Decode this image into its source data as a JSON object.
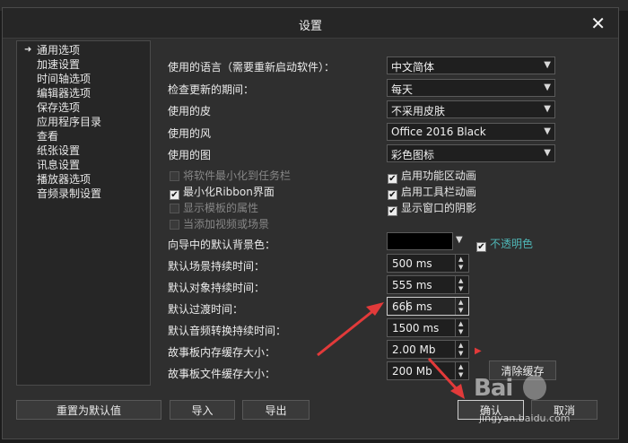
{
  "dialog": {
    "title": "设置",
    "close_label": "✕"
  },
  "nav": {
    "items": [
      {
        "label": "通用选项",
        "selected": true
      },
      {
        "label": "加速设置"
      },
      {
        "label": "时间轴选项"
      },
      {
        "label": "编辑器选项"
      },
      {
        "label": "保存选项"
      },
      {
        "label": "应用程序目录"
      },
      {
        "label": "查看"
      },
      {
        "label": "纸张设置"
      },
      {
        "label": "讯息设置"
      },
      {
        "label": "播放器选项"
      },
      {
        "label": "音频录制设置"
      }
    ]
  },
  "settings": {
    "language": {
      "label": "使用的语言（需要重新启动软件）：",
      "value": "中文简体"
    },
    "update_period": {
      "label": "检查更新的期间：",
      "value": "每天"
    },
    "skin": {
      "label": "使用的皮",
      "value": "不采用皮肤"
    },
    "style": {
      "label": "使用的风",
      "value": "Office 2016 Black"
    },
    "icons": {
      "label": "使用的图",
      "value": "彩色图标"
    }
  },
  "checkboxes": {
    "minimize_tray": {
      "label": "将软件最小化到任务栏",
      "checked": false
    },
    "enable_ribbon_anim": {
      "label": "启用功能区动画",
      "checked": true
    },
    "minimize_ribbon": {
      "label": "最小化Ribbon界面",
      "checked": true
    },
    "enable_toolbar_anim": {
      "label": "启用工具栏动画",
      "checked": true
    },
    "show_template_props": {
      "label": "显示模板的属性",
      "checked": false
    },
    "show_window_shadow": {
      "label": "显示窗口的阴影",
      "checked": true
    },
    "add_video_scene": {
      "label": "当添加视频或场景",
      "checked": false
    },
    "opaque": {
      "label": "不透明色",
      "checked": true
    }
  },
  "defaults": {
    "wizard_bg_label": "向导中的默认背景色：",
    "wizard_bg_color": "#000000",
    "scene_duration": {
      "label": "默认场景持续时间：",
      "value": "500 ms"
    },
    "object_duration": {
      "label": "默认对象持续时间：",
      "value": "555 ms"
    },
    "transition_time": {
      "label": "默认过渡时间：",
      "value": "666 ms"
    },
    "audio_transition": {
      "label": "默认音频转换持续时间：",
      "value": "1500 ms"
    },
    "storyboard_memory": {
      "label": "故事板内存缓存大小：",
      "value": "2.00 Mb"
    },
    "storyboard_file": {
      "label": "故事板文件缓存大小：",
      "value": "200 Mb"
    }
  },
  "buttons": {
    "clear_cache": "清除缓存",
    "reset": "重置为默认值",
    "import": "导入",
    "export": "导出",
    "ok": "确认",
    "cancel": "取消"
  },
  "icons": {
    "nav_selected": "arrow-right-icon",
    "close": "close-icon"
  },
  "colors": {
    "annotation_red": "#e23a3a",
    "accent_teal": "#4fb7b7"
  },
  "watermark": {
    "logo": "Bai",
    "url": "jingyan.baidu.com"
  }
}
